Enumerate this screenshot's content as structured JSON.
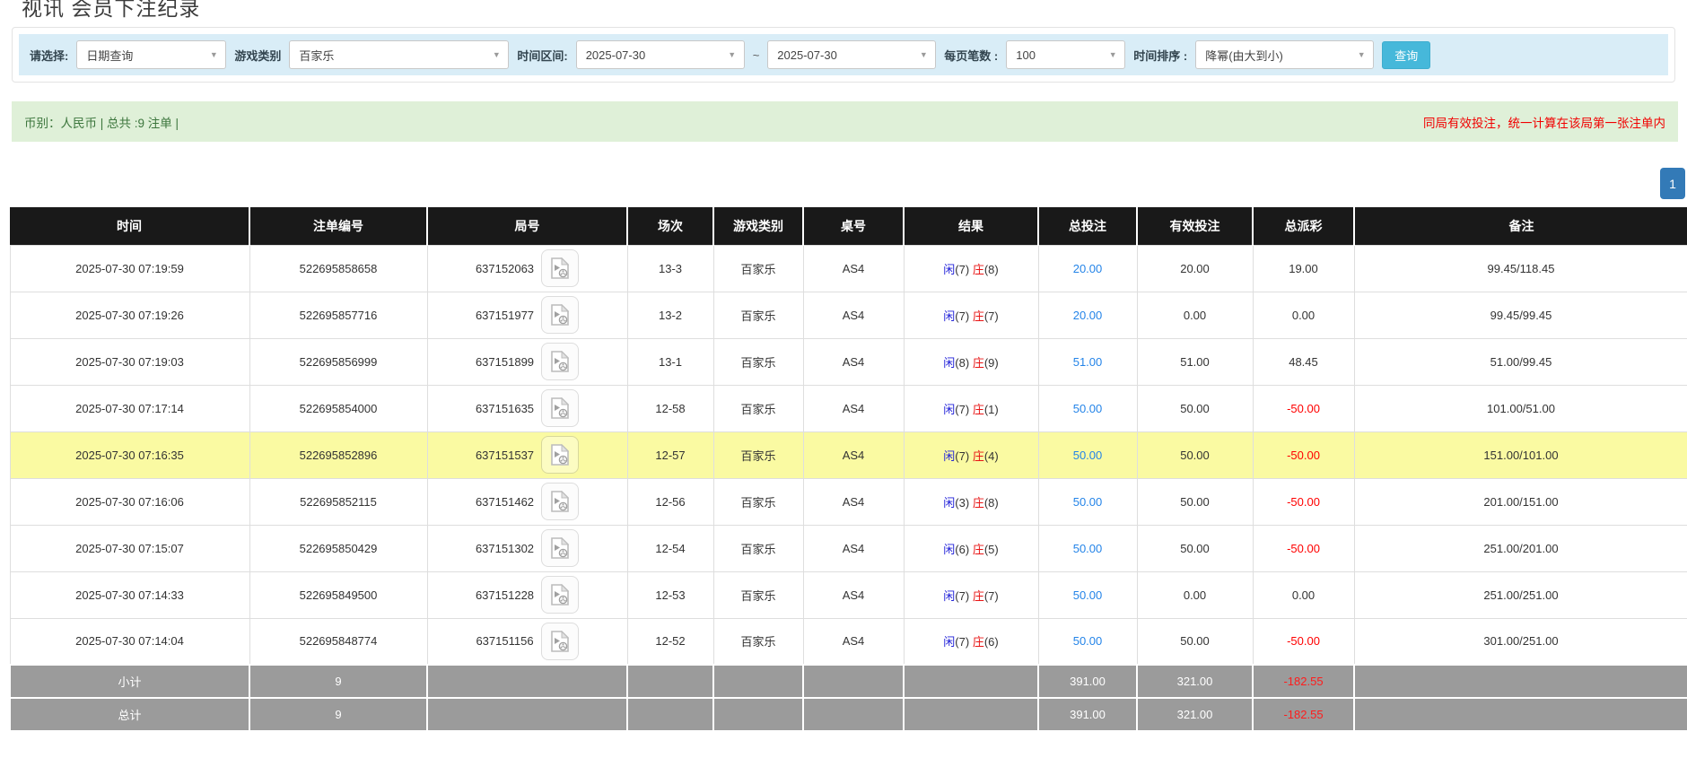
{
  "page": {
    "title": "视讯 会员下注纪录"
  },
  "filters": {
    "query_type_label": "请选择:",
    "query_type_value": "日期查询",
    "game_type_label": "游戏类别",
    "game_type_value": "百家乐",
    "date_range_label": "时间区间:",
    "date_from": "2025-07-30",
    "date_separator": "~",
    "date_to": "2025-07-30",
    "page_size_label": "每页笔数 :",
    "page_size_value": "100",
    "sort_label": "时间排序 :",
    "sort_value": "降幂(由大到小)",
    "search_button_label": "查询"
  },
  "summary_bar": {
    "currency_info": "币别：人民币 | 总共 :9 注单 |",
    "note": "同局有效投注，统一计算在该局第一张注单内"
  },
  "pagination": {
    "current_page": "1"
  },
  "table": {
    "headers": [
      "时间",
      "注单编号",
      "局号",
      "场次",
      "游戏类别",
      "桌号",
      "结果",
      "总投注",
      "有效投注",
      "总派彩",
      "备注"
    ],
    "rows": [
      {
        "time": "2025-07-30 07:19:59",
        "bet_id": "522695858658",
        "round_id": "637152063",
        "session": "13-3",
        "game_type": "百家乐",
        "table_no": "AS4",
        "result": {
          "player_label": "闲",
          "player_score": "(7)",
          "banker_label": "庄",
          "banker_score": "(8)"
        },
        "total_bet": "20.00",
        "valid_bet": "20.00",
        "payout": "19.00",
        "payout_negative": false,
        "remark": "99.45/118.45",
        "highlighted": false
      },
      {
        "time": "2025-07-30 07:19:26",
        "bet_id": "522695857716",
        "round_id": "637151977",
        "session": "13-2",
        "game_type": "百家乐",
        "table_no": "AS4",
        "result": {
          "player_label": "闲",
          "player_score": "(7)",
          "banker_label": "庄",
          "banker_score": "(7)"
        },
        "total_bet": "20.00",
        "valid_bet": "0.00",
        "payout": "0.00",
        "payout_negative": false,
        "remark": "99.45/99.45",
        "highlighted": false
      },
      {
        "time": "2025-07-30 07:19:03",
        "bet_id": "522695856999",
        "round_id": "637151899",
        "session": "13-1",
        "game_type": "百家乐",
        "table_no": "AS4",
        "result": {
          "player_label": "闲",
          "player_score": "(8)",
          "banker_label": "庄",
          "banker_score": "(9)"
        },
        "total_bet": "51.00",
        "valid_bet": "51.00",
        "payout": "48.45",
        "payout_negative": false,
        "remark": "51.00/99.45",
        "highlighted": false
      },
      {
        "time": "2025-07-30 07:17:14",
        "bet_id": "522695854000",
        "round_id": "637151635",
        "session": "12-58",
        "game_type": "百家乐",
        "table_no": "AS4",
        "result": {
          "player_label": "闲",
          "player_score": "(7)",
          "banker_label": "庄",
          "banker_score": "(1)"
        },
        "total_bet": "50.00",
        "valid_bet": "50.00",
        "payout": "-50.00",
        "payout_negative": true,
        "remark": "101.00/51.00",
        "highlighted": false
      },
      {
        "time": "2025-07-30 07:16:35",
        "bet_id": "522695852896",
        "round_id": "637151537",
        "session": "12-57",
        "game_type": "百家乐",
        "table_no": "AS4",
        "result": {
          "player_label": "闲",
          "player_score": "(7)",
          "banker_label": "庄",
          "banker_score": "(4)"
        },
        "total_bet": "50.00",
        "valid_bet": "50.00",
        "payout": "-50.00",
        "payout_negative": true,
        "remark": "151.00/101.00",
        "highlighted": true
      },
      {
        "time": "2025-07-30 07:16:06",
        "bet_id": "522695852115",
        "round_id": "637151462",
        "session": "12-56",
        "game_type": "百家乐",
        "table_no": "AS4",
        "result": {
          "player_label": "闲",
          "player_score": "(3)",
          "banker_label": "庄",
          "banker_score": "(8)"
        },
        "total_bet": "50.00",
        "valid_bet": "50.00",
        "payout": "-50.00",
        "payout_negative": true,
        "remark": "201.00/151.00",
        "highlighted": false
      },
      {
        "time": "2025-07-30 07:15:07",
        "bet_id": "522695850429",
        "round_id": "637151302",
        "session": "12-54",
        "game_type": "百家乐",
        "table_no": "AS4",
        "result": {
          "player_label": "闲",
          "player_score": "(6)",
          "banker_label": "庄",
          "banker_score": "(5)"
        },
        "total_bet": "50.00",
        "valid_bet": "50.00",
        "payout": "-50.00",
        "payout_negative": true,
        "remark": "251.00/201.00",
        "highlighted": false
      },
      {
        "time": "2025-07-30 07:14:33",
        "bet_id": "522695849500",
        "round_id": "637151228",
        "session": "12-53",
        "game_type": "百家乐",
        "table_no": "AS4",
        "result": {
          "player_label": "闲",
          "player_score": "(7)",
          "banker_label": "庄",
          "banker_score": "(7)"
        },
        "total_bet": "50.00",
        "valid_bet": "0.00",
        "payout": "0.00",
        "payout_negative": false,
        "remark": "251.00/251.00",
        "highlighted": false
      },
      {
        "time": "2025-07-30 07:14:04",
        "bet_id": "522695848774",
        "round_id": "637151156",
        "session": "12-52",
        "game_type": "百家乐",
        "table_no": "AS4",
        "result": {
          "player_label": "闲",
          "player_score": "(7)",
          "banker_label": "庄",
          "banker_score": "(6)"
        },
        "total_bet": "50.00",
        "valid_bet": "50.00",
        "payout": "-50.00",
        "payout_negative": true,
        "remark": "301.00/251.00",
        "highlighted": false
      }
    ],
    "subtotal": {
      "label": "小计",
      "count": "9",
      "total_bet": "391.00",
      "valid_bet": "321.00",
      "payout": "-182.55"
    },
    "grand_total": {
      "label": "总计",
      "count": "9",
      "total_bet": "391.00",
      "valid_bet": "321.00",
      "payout": "-182.55"
    }
  },
  "icons": {
    "dropdown_caret": "▼"
  },
  "colors": {
    "header_bg": "#191919",
    "filter_bar_bg": "#d9edf7",
    "summary_bar_bg": "#dff0d8",
    "summary_text": "#3c763d",
    "note_red": "#f10000",
    "search_button_bg": "#46b8da",
    "pagination_bg": "#337ab7",
    "highlight_row_bg": "#fafaa2",
    "player_blue": "#1f1fd8",
    "banker_red": "#e81414",
    "amount_link_blue": "#2484e8",
    "negative_red": "#ff0000",
    "summary_row_bg": "#9b9b9b"
  }
}
